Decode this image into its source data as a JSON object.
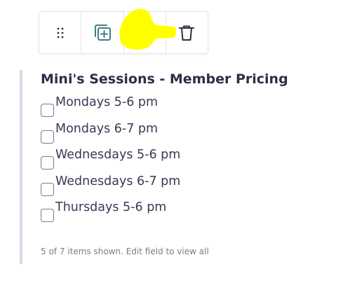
{
  "toolbar": {
    "tools": [
      {
        "icon": "drag-handle-icon"
      },
      {
        "icon": "duplicate-icon"
      },
      {
        "icon": "settings-sliders-icon"
      },
      {
        "icon": "trash-icon"
      }
    ],
    "highlight_color": "#ffff00"
  },
  "field": {
    "title": "Mini's Sessions - Member Pricing",
    "options": [
      {
        "label": "Mondays 5-6 pm",
        "checked": false
      },
      {
        "label": "Mondays 6-7 pm",
        "checked": false
      },
      {
        "label": "Wednesdays 5-6 pm",
        "checked": false
      },
      {
        "label": "Wednesdays 6-7 pm",
        "checked": false
      },
      {
        "label": "Thursdays 5-6 pm",
        "checked": false
      }
    ],
    "note": "5 of 7 items shown. Edit field to view all"
  },
  "colors": {
    "icon": "#2b3140",
    "accent_teal": "#3f7f8c",
    "border_accent": "#d6d7e6"
  }
}
